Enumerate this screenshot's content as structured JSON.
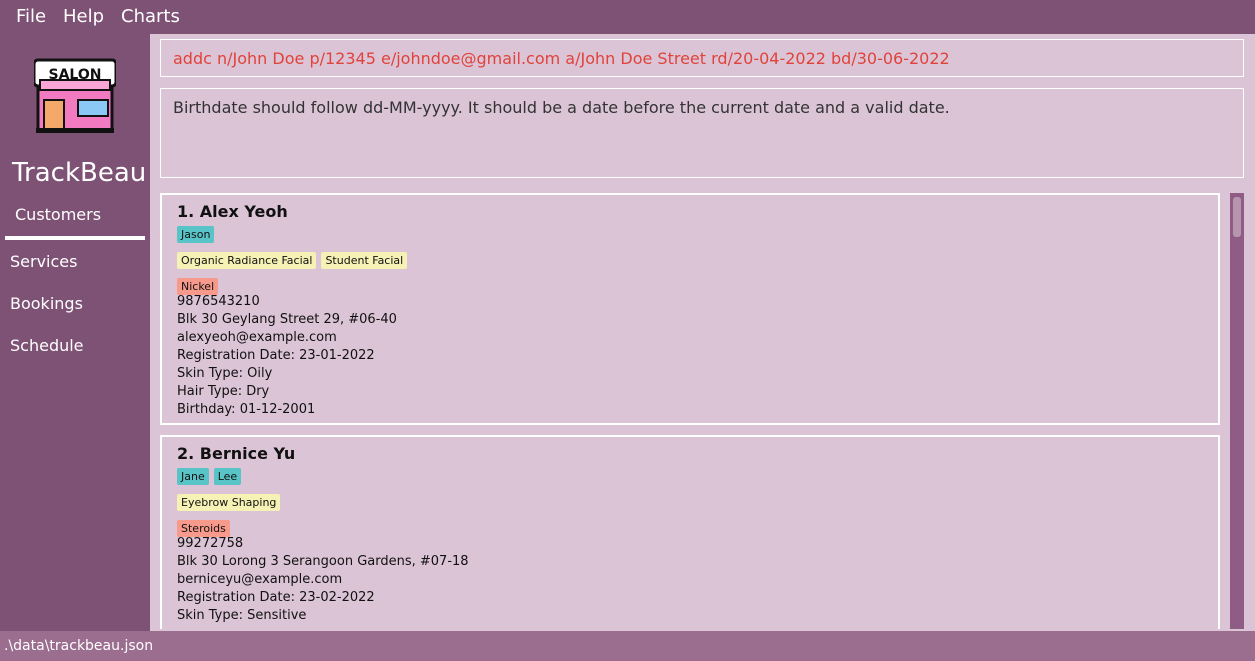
{
  "menu": {
    "file": "File",
    "help": "Help",
    "charts": "Charts"
  },
  "app": {
    "name": "TrackBeau",
    "logo_text": "SALON"
  },
  "nav": {
    "customers": "Customers",
    "services": "Services",
    "bookings": "Bookings",
    "schedule": "Schedule",
    "active": "Customers"
  },
  "command": {
    "text": "addc n/John Doe p/12345 e/johndoe@gmail.com a/John Doe Street rd/20-04-2022 bd/30-06-2022"
  },
  "result": {
    "text": "Birthdate should follow dd-MM-yyyy. It should be a date before the current date and a valid date."
  },
  "customers": [
    {
      "title": "1.  Alex Yeoh",
      "staff": [
        "Jason"
      ],
      "services": [
        "Organic Radiance Facial",
        "Student Facial"
      ],
      "allergies": [
        "Nickel"
      ],
      "phone": "9876543210",
      "address": "Blk 30 Geylang Street 29, #06-40",
      "email": "alexyeoh@example.com",
      "registration": "Registration Date: 23-01-2022",
      "skin": "Skin Type: Oily",
      "hair": "Hair Type: Dry",
      "birthday": "Birthday: 01-12-2001"
    },
    {
      "title": "2.  Bernice Yu",
      "staff": [
        "Jane",
        "Lee"
      ],
      "services": [
        "Eyebrow Shaping"
      ],
      "allergies": [
        "Steroids"
      ],
      "phone": "99272758",
      "address": "Blk 30 Lorong 3 Serangoon Gardens, #07-18",
      "email": "berniceyu@example.com",
      "registration": "Registration Date: 23-02-2022",
      "skin": "Skin Type: Sensitive"
    }
  ],
  "status": {
    "path": ".\\data\\trackbeau.json"
  },
  "colors": {
    "primary": "#7e5275",
    "panel": "#dbc4d6",
    "error_text": "#e0433a",
    "staff_tag": "#59c4c8",
    "service_tag": "#f6f2b5",
    "allergy_tag": "#f79a8c"
  }
}
